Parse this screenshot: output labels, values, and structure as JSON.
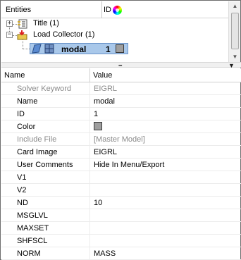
{
  "tree": {
    "header": {
      "entities_label": "Entities",
      "id_label": "ID",
      "color_icon": "color-wheel-icon"
    },
    "items": [
      {
        "label": "Title (1)",
        "expander": "+",
        "icon": "title-icon"
      },
      {
        "label": "Load Collector (1)",
        "expander": "−",
        "icon": "load-collector-icon"
      }
    ],
    "selected": {
      "name": "modal",
      "id": "1",
      "color": "#9e9e9e"
    }
  },
  "properties": {
    "header": {
      "name": "Name",
      "value": "Value"
    },
    "rows": [
      {
        "name": "Solver Keyword",
        "value": "EIGRL",
        "muted": true
      },
      {
        "name": "Name",
        "value": "modal"
      },
      {
        "name": "ID",
        "value": "1"
      },
      {
        "name": "Color",
        "value": "",
        "swatch": "#9e9e9e"
      },
      {
        "name": "Include File",
        "value": "[Master Model]",
        "muted": true
      },
      {
        "name": "Card Image",
        "value": "EIGRL"
      },
      {
        "name": "User Comments",
        "value": "Hide In Menu/Export"
      },
      {
        "name": "V1",
        "value": ""
      },
      {
        "name": "V2",
        "value": ""
      },
      {
        "name": "ND",
        "value": "10"
      },
      {
        "name": "MSGLVL",
        "value": ""
      },
      {
        "name": "MAXSET",
        "value": ""
      },
      {
        "name": "SHFSCL",
        "value": ""
      },
      {
        "name": "NORM",
        "value": "MASS"
      }
    ]
  }
}
